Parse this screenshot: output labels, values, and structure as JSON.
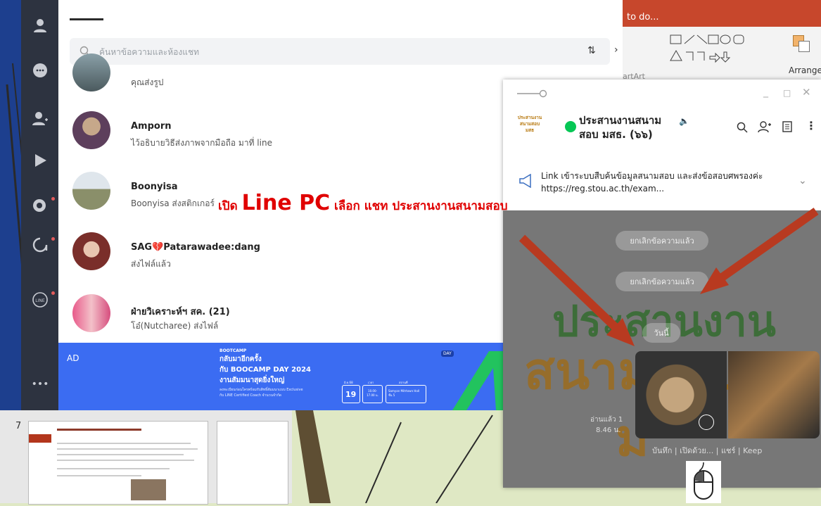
{
  "ppt": {
    "tell_me": "to do...",
    "arrange_label": "Arrange",
    "smartart_label": "artArt",
    "slide_number": "7"
  },
  "search": {
    "placeholder": "ค้นหาข้อความและห้องแชท"
  },
  "chats": [
    {
      "name": "",
      "message": "คุณส่งรูป"
    },
    {
      "name": "Amporn",
      "message": "ไว้อธิบายวิธีส่งภาพจากมือถือ มาที่ line"
    },
    {
      "name": "Boonyisa",
      "message": "Boonyisa ส่งสติกเกอร์"
    },
    {
      "name": "SAG💔Patarawadee:dang",
      "message": "ส่งไฟล์แล้ว"
    },
    {
      "name": "ฝ่ายวิเคราะห์ฯ สค. (21)",
      "message": "โอ๋(Nutcharee) ส่งไฟล์"
    }
  ],
  "ad": {
    "tag": "AD",
    "bootcamp": "BOOTCAMP",
    "line1": "กลับมาอีกครั้ง",
    "line2": "กับ BOOCAMP DAY 2024",
    "line3": "งานสัมมนาสุดยิ่งใหญ่",
    "fine": "ลงทะเบียนก่อนใครพร้อมรับสิทธิ์สัมมนาแบบ Exclusive",
    "fine2": "กับ LINE Certified Coach จำนวนจำกัด",
    "day_badge": "DAY",
    "date_num": "19",
    "date_head": "มิ.ย.68",
    "time_head": "เวลา",
    "time_val": "10.00-17.00 น.",
    "venue_head": "สถานที่",
    "venue_val": "Samyan Mitrtown Hall ชั้น 5"
  },
  "chat_window": {
    "group_logo_text": "ประสานงาน สนามสอบ มสธ",
    "title": "ประสานงานสนาม สอบ มสธ. (๖๖)",
    "announcement": "Link  เข้าระบบสืบค้นข้อมูลสนามสอบ และส่งข้อสอบศพรองค่ะ https://reg.stou.ac.th/exam...",
    "cancelled_1": "ยกเลิกข้อความแล้ว",
    "cancelled_2": "ยกเลิกข้อความแล้ว",
    "today": "วันนี้",
    "bg_text_1": "ประสานงาน",
    "bg_text_2": "สนามสอบ",
    "bg_text_3": "ม",
    "read_label": "อ่านแล้ว 1",
    "time": "8.46 น.",
    "actions": "บันทึก | เปิดด้วย... | แชร์ | Keep"
  },
  "overlay": {
    "prefix": "เปิด ",
    "big": "Line PC",
    "suffix": " เลือก แชท ประสานงานสนามสอบ"
  },
  "colors": {
    "sidebar": "#2d3340",
    "line_green": "#06c755",
    "ppt_red": "#c7472c",
    "ad_blue": "#3b6cf2",
    "arrow": "#b83a20",
    "overlay": "#e00000"
  }
}
